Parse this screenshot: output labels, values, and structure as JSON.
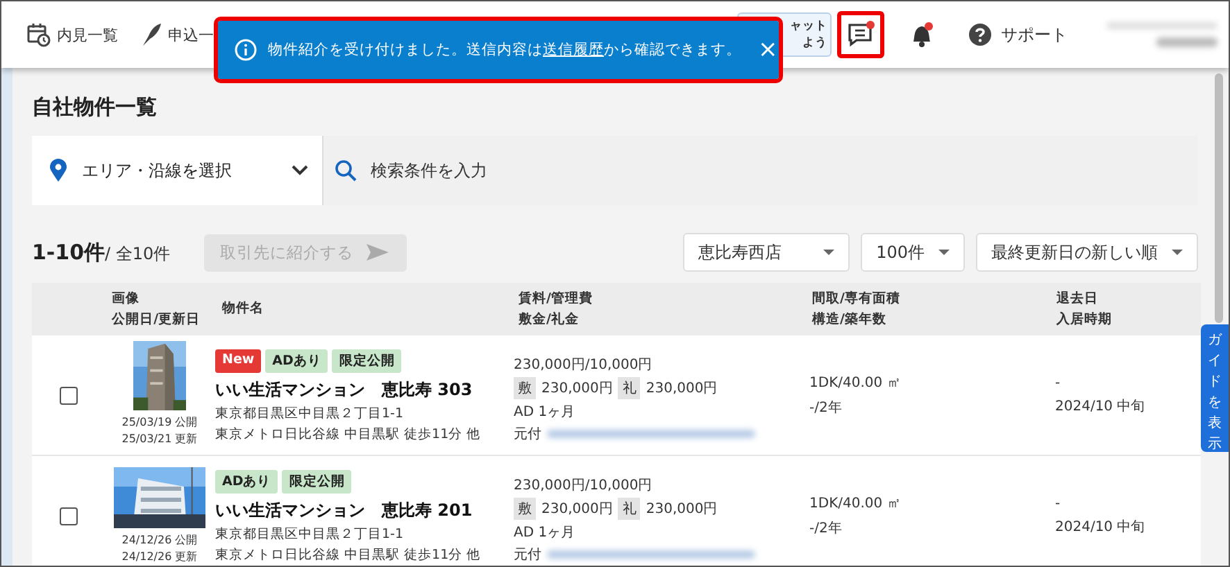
{
  "header": {
    "nav": [
      {
        "label": "内見一覧",
        "kind": "calendar"
      },
      {
        "label": "申込一",
        "kind": "pen"
      }
    ],
    "chat_promo": {
      "line_1": "ャット",
      "line_2": "よう"
    },
    "chat_button": {
      "unread": true,
      "highlighted": true
    },
    "bell": {
      "unread": true
    },
    "support": "サポート"
  },
  "toast": {
    "before": "物件紹介を受け付けました。送信内容は",
    "link": "送信履歴",
    "after": "から確認できます。",
    "close": "×",
    "highlighted": true
  },
  "page_title": "自社物件一覧",
  "search": {
    "area_label": "エリア・沿線を選択",
    "placeholder": "検索条件を入力"
  },
  "result": {
    "range": "1-10件",
    "total": "/ 全10件",
    "introduce_button": {
      "label": "取引先に紹介する",
      "disabled": true
    },
    "store": "恵比寿西店",
    "per_page": "100件",
    "sort": "最終更新日の新しい順"
  },
  "table": {
    "columns": [
      {
        "line_1": "画像",
        "line_2": "公開日/更新日"
      },
      {
        "line_1": "物件名"
      },
      {
        "line_1": "賃料/管理費",
        "line_2": "敷金/礼金"
      },
      {
        "line_1": "間取/専有面積",
        "line_2": "構造/築年数"
      },
      {
        "line_1": "退去日",
        "line_2": "入居時期"
      }
    ],
    "rows": [
      {
        "checked": false,
        "photo": {
          "kind": "picture"
        },
        "published": "25/03/19 公開",
        "updated": "25/03/21 更新",
        "tags": [
          {
            "label": "New",
            "kind": "new"
          },
          {
            "label": "ADあり",
            "kind": "green"
          },
          {
            "label": "限定公開",
            "kind": "green"
          }
        ],
        "name": "いい生活マンション　恵比寿 303",
        "address": "東京都目黒区中目黒２丁目1-1",
        "access": "東京メトロ日比谷線 中目黒駅 徒歩11分 他",
        "rent": "230,000円/10,000円",
        "deposit_mark": "敷",
        "deposit": "230,000円",
        "key_money_mark": "礼",
        "key_money": "230,000円",
        "ad": "AD 1ヶ月",
        "agent_label": "元付",
        "layout": "1DK/40.00 ㎡",
        "structure": "-/2年",
        "move_out": "-",
        "move_in": "2024/10 中旬"
      },
      {
        "checked": false,
        "photo": {
          "kind": "picture"
        },
        "published": "24/12/26 公開",
        "updated": "24/12/26 更新",
        "tags": [
          {
            "label": "ADあり",
            "kind": "green"
          },
          {
            "label": "限定公開",
            "kind": "green"
          }
        ],
        "name": "いい生活マンション　恵比寿 201",
        "address": "東京都目黒区中目黒２丁目1-1",
        "access": "東京メトロ日比谷線 中目黒駅 徒歩11分 他",
        "rent": "230,000円/10,000円",
        "deposit_mark": "敷",
        "deposit": "230,000円",
        "key_money_mark": "礼",
        "key_money": "230,000円",
        "ad": "AD 1ヶ月",
        "agent_label": "元付",
        "layout": "1DK/40.00 ㎡",
        "structure": "-/2年",
        "move_out": "-",
        "move_in": "2024/10 中旬"
      }
    ]
  },
  "guide_tab": "ガイドを表示"
}
